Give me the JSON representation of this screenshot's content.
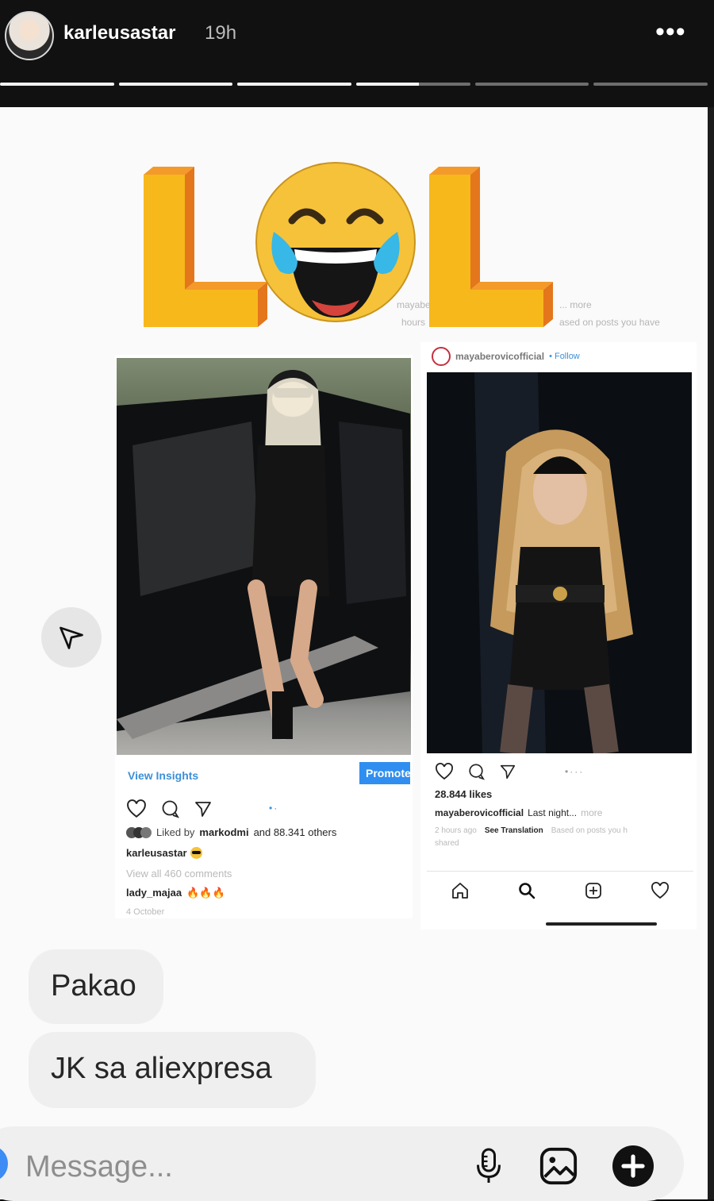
{
  "story": {
    "username": "karleusastar",
    "time": "19h",
    "more_label": "•••",
    "progress": [
      1,
      1,
      1,
      0.55,
      0,
      0
    ]
  },
  "sticker": {
    "left_letter": "L",
    "right_letter": "L"
  },
  "post_left": {
    "view_insights": "View Insights",
    "promote": "Promote",
    "liked_by_prefix": "Liked by",
    "liked_by_user": "markodmi",
    "liked_by_suffix": "and 88.341 others",
    "caption_user": "karleusastar",
    "view_comments": "View all 460 comments",
    "comment_user": "lady_majaa",
    "comment_text": "🔥🔥🔥",
    "date": "4 October"
  },
  "post_right": {
    "header_user": "mayaberovicofficial",
    "header_follow": "• Follow",
    "faded_user": "mayabe",
    "faded_more": "... more",
    "faded_line2": "hours",
    "faded_line2b": "ased on posts you have",
    "likes": "28.844 likes",
    "caption_user": "mayaberovicofficial",
    "caption_text": "Last night...",
    "caption_more": "more",
    "ago": "2 hours ago",
    "see_translation": "See Translation",
    "based": "Based on posts you h",
    "shared": "shared"
  },
  "messages": [
    "Pakao",
    "JK sa aliexpresa"
  ],
  "composer": {
    "placeholder": "Message..."
  },
  "colors": {
    "accent": "#3d8bf5",
    "sticker_yellow": "#f7b81c",
    "sticker_orange": "#e4761b"
  }
}
